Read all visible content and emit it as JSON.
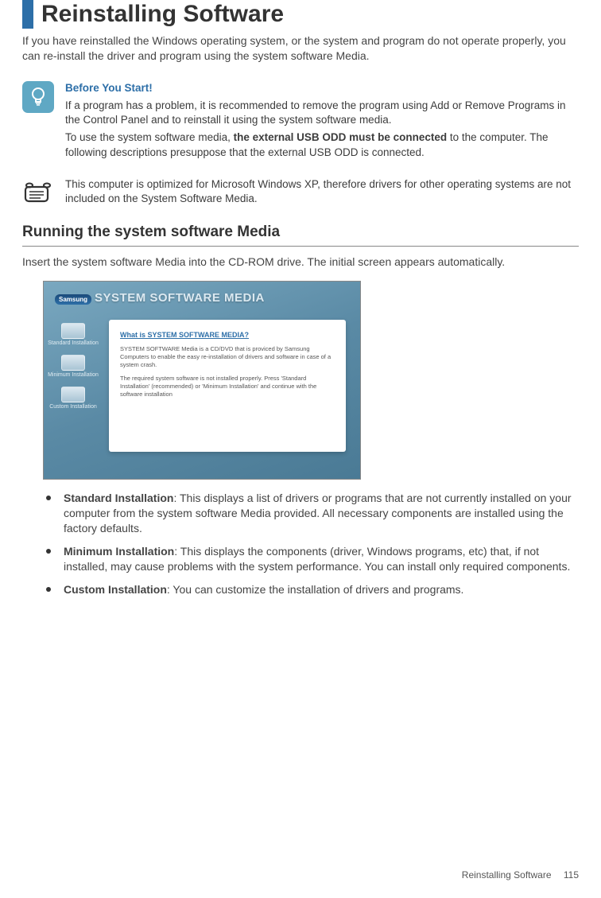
{
  "title": "Reinstalling Software",
  "intro": "If you have reinstalled the Windows operating system, or the system and program do not operate properly, you can re-install the driver and program using the system software Media.",
  "tip": {
    "heading": "Before You Start!",
    "p1": "If a program has a problem, it is recommended to remove the program using Add or Remove Programs in the Control Panel and to reinstall it using the system software media.",
    "p2a": "To use the system software media, ",
    "p2b": "the external USB ODD must be connected",
    "p2c": " to the computer. The following descriptions presuppose that the external USB ODD is connected."
  },
  "note": {
    "text": "This computer is optimized for Microsoft Windows XP, therefore drivers for other operating systems are not included on the System Software Media."
  },
  "section": {
    "heading": "Running the system software Media",
    "lead": "Insert the system software Media into the CD-ROM drive. The initial screen appears automatically."
  },
  "screenshot": {
    "brand": "Samsung",
    "title": "SYSTEM SOFTWARE MEDIA",
    "close": "×",
    "opts": {
      "standard": "Standard Installation",
      "minimum": "Minimum Installation",
      "custom": "Custom Installation"
    },
    "panel": {
      "q": "What is SYSTEM SOFTWARE MEDIA?",
      "p1": "SYSTEM SOFTWARE Media is a CD/DVD that is proviced by Samsung Computers to enable the easy re-installation of drivers and software in case of a system crash.",
      "p2": "The required system software is not installed properly. Press 'Standard Installation' (recommended) or 'Minimum Installation' and continue with the software installation"
    }
  },
  "bullets": [
    {
      "label": "Standard Installation",
      "text": ": This displays a list of drivers or programs that are not currently installed on your computer from the system software Media provided. All necessary components are installed using the factory defaults."
    },
    {
      "label": "Minimum Installation",
      "text": ": This displays the components (driver, Windows programs, etc) that, if not installed, may cause problems with the system performance. You can install only required components."
    },
    {
      "label": "Custom Installation",
      "text": ": You can customize the installation of drivers and programs."
    }
  ],
  "footer": {
    "section": "Reinstalling Software",
    "page": "115"
  }
}
